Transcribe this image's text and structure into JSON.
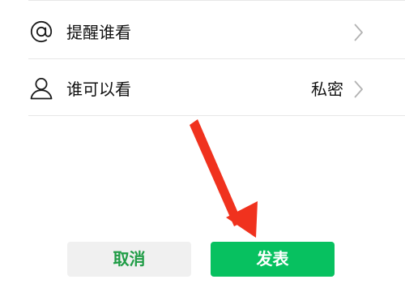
{
  "settings_list": {
    "items": [
      {
        "icon": "at-sign-icon",
        "label": "提醒谁看",
        "value": ""
      },
      {
        "icon": "user-icon",
        "label": "谁可以看",
        "value": "私密"
      }
    ]
  },
  "actions": {
    "cancel_label": "取消",
    "publish_label": "发表"
  },
  "colors": {
    "accent_green": "#07c160",
    "cancel_text_green": "#1f9c45",
    "cancel_bg": "#f0f0f0",
    "annotation_red": "#f0321e",
    "divider": "#e7e7e7",
    "chevron": "#b2b2b2"
  }
}
